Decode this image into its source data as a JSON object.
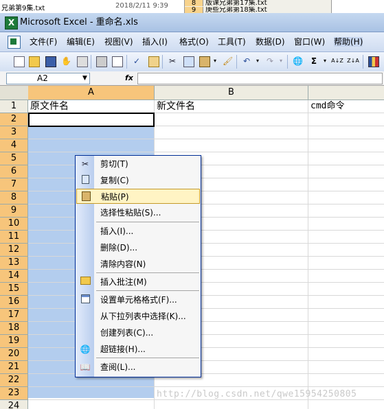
{
  "background": {
    "file_name": "兄弟第9集.txt",
    "date": "2018/2/11 9:39",
    "panel_rows": [
      {
        "num": "8",
        "text": "版课兄弟第17集.txt"
      },
      {
        "num": "9",
        "text": "庚些兄弟第18集.txt"
      }
    ]
  },
  "window": {
    "title": "Microsoft Excel - 重命名.xls",
    "logo": "X"
  },
  "menu": {
    "items": [
      "文件(F)",
      "编辑(E)",
      "视图(V)",
      "插入(I)",
      "格式(O)",
      "工具(T)",
      "数据(D)",
      "窗口(W)",
      "帮助(H)"
    ]
  },
  "toolbar": {
    "icons": [
      "new-icon",
      "open-icon",
      "save-icon",
      "permission-icon",
      "email-icon",
      "print-icon",
      "print-preview-icon",
      "spelling-icon",
      "research-icon",
      "cut-icon",
      "copy-icon",
      "paste-icon",
      "format-painter-icon",
      "undo-icon",
      "redo-icon",
      "hyperlink-icon",
      "autosum-icon",
      "sort-ascending-icon",
      "sort-descending-icon",
      "chart-wizard-icon"
    ],
    "sum_glyph": "Σ",
    "sort_asc_glyph": "A↓Z",
    "sort_desc_glyph": "Z↓A"
  },
  "formula_bar": {
    "name_box": "A2",
    "fx": "fx",
    "value": ""
  },
  "sheet": {
    "columns": [
      "A",
      "B"
    ],
    "rows": [
      "1",
      "2",
      "3",
      "4",
      "5",
      "6",
      "7",
      "8",
      "9",
      "10",
      "11",
      "12",
      "13",
      "14",
      "15",
      "16",
      "17",
      "18",
      "19",
      "20",
      "21",
      "22",
      "23",
      "24"
    ],
    "row1": {
      "a": "原文件名",
      "b": "新文件名",
      "c": "cmd命令"
    }
  },
  "context_menu": {
    "items": [
      {
        "label": "剪切(T)",
        "icon": "scissors-icon"
      },
      {
        "label": "复制(C)",
        "icon": "copy-icon"
      },
      {
        "label": "粘贴(P)",
        "icon": "clipboard-icon"
      },
      {
        "label": "选择性粘贴(S)...",
        "icon": ""
      },
      {
        "label": "插入(I)...",
        "icon": ""
      },
      {
        "label": "删除(D)...",
        "icon": ""
      },
      {
        "label": "清除内容(N)",
        "icon": ""
      },
      {
        "label": "插入批注(M)",
        "icon": "folder-comment-icon"
      },
      {
        "label": "设置单元格格式(F)...",
        "icon": "format-cells-icon"
      },
      {
        "label": "从下拉列表中选择(K)...",
        "icon": ""
      },
      {
        "label": "创建列表(C)...",
        "icon": ""
      },
      {
        "label": "超链接(H)...",
        "icon": "hyperlink-icon"
      },
      {
        "label": "查阅(L)...",
        "icon": "research-icon"
      }
    ]
  },
  "watermark": "http://blog.csdn.net/qwe15954250805",
  "colors": {
    "selection": "#b3cdee",
    "header_selected": "#f7c57b",
    "menu_highlight": "#fff4c4"
  }
}
